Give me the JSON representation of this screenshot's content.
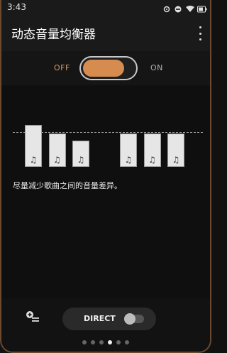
{
  "status_bar": {
    "time": "3:43",
    "icons": [
      "settings-icon",
      "dnd-icon",
      "wifi-icon",
      "battery-icon"
    ]
  },
  "app_bar": {
    "title": "动态音量均衡器",
    "menu_icon": "more-vert-icon"
  },
  "power_toggle": {
    "off_label": "OFF",
    "on_label": "ON",
    "state": "off",
    "accent": "#d68b4f"
  },
  "equalizer": {
    "levels": [
      0.75,
      0.5,
      0.3,
      0,
      0.5,
      0.5,
      0.5
    ],
    "note_glyph": "♫"
  },
  "description": "尽量减少歌曲之间的音量差异。",
  "bottom_bar": {
    "add_list_icon": "playlist-add-icon",
    "direct_label": "DIRECT",
    "direct_state": "off"
  },
  "page_indicator": {
    "count": 6,
    "active_index": 3
  }
}
